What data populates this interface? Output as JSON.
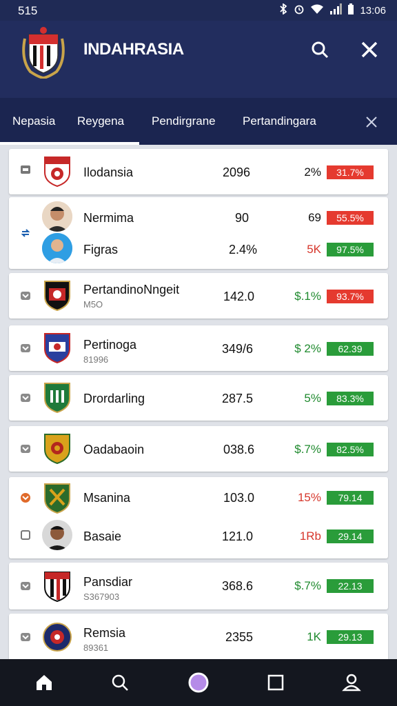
{
  "status_bar": {
    "left_text": "515",
    "time": "13:06"
  },
  "app": {
    "title": "INDAHRASIA"
  },
  "tabs": [
    {
      "label": "Nepasia"
    },
    {
      "label": "Reygena"
    },
    {
      "label": "Pendirgrane"
    },
    {
      "label": "Pertandingara"
    }
  ],
  "rows": [
    {
      "name": "Ilodansia",
      "value": "2096",
      "percent": "2%",
      "badge": "31.7%",
      "badge_color": "red",
      "percent_color": "dark"
    },
    {
      "name": "Nermima",
      "value": "90",
      "percent": "69",
      "badge": "55.5%",
      "badge_color": "red",
      "percent_color": "dark"
    },
    {
      "name": "Figras",
      "value": "2.4%",
      "percent": "5K",
      "badge": "97.5%",
      "badge_color": "green",
      "percent_color": "red"
    },
    {
      "name": "PertandinoNngeit",
      "sub": "M5O",
      "value": "142.0",
      "percent": "$.1%",
      "badge": "93.7%",
      "badge_color": "red",
      "percent_color": "green"
    },
    {
      "name": "Pertinoga",
      "sub": "81996",
      "value": "349/6",
      "percent": "$ 2%",
      "badge": "62.39",
      "badge_color": "green",
      "percent_color": "green"
    },
    {
      "name": "Drordarling",
      "value": "287.5",
      "percent": "5%",
      "badge": "83.3%",
      "badge_color": "green",
      "percent_color": "green"
    },
    {
      "name": "Oadabaoin",
      "value": "038.6",
      "percent": "$.7%",
      "badge": "82.5%",
      "badge_color": "green",
      "percent_color": "green"
    },
    {
      "name": "Msanina",
      "value": "103.0",
      "percent": "15%",
      "badge": "79.14",
      "badge_color": "green",
      "percent_color": "red"
    },
    {
      "name": "Basaie",
      "value": "121.0",
      "percent": "1Rb",
      "badge": "29.14",
      "badge_color": "green",
      "percent_color": "red"
    },
    {
      "name": "Pansdiar",
      "sub": "S367903",
      "value": "368.6",
      "percent": "$.7%",
      "badge": "22.13",
      "badge_color": "green",
      "percent_color": "green"
    },
    {
      "name": "Remsia",
      "sub": "89361",
      "value": "2355",
      "percent": "1K",
      "badge": "29.13",
      "badge_color": "green",
      "percent_color": "green"
    }
  ],
  "icons": {
    "status": [
      "bluetooth-icon",
      "alarm-icon",
      "wifi-icon",
      "signal-icon",
      "battery-icon"
    ],
    "header": [
      "search-icon",
      "close-icon"
    ],
    "nav": [
      "home-icon",
      "search-icon",
      "record-icon",
      "square-icon",
      "profile-icon"
    ]
  },
  "colors": {
    "header_bg": "#222d5e",
    "badge_red": "#e53a2f",
    "badge_green": "#2a9c3a",
    "nav_bg": "#14171f"
  }
}
